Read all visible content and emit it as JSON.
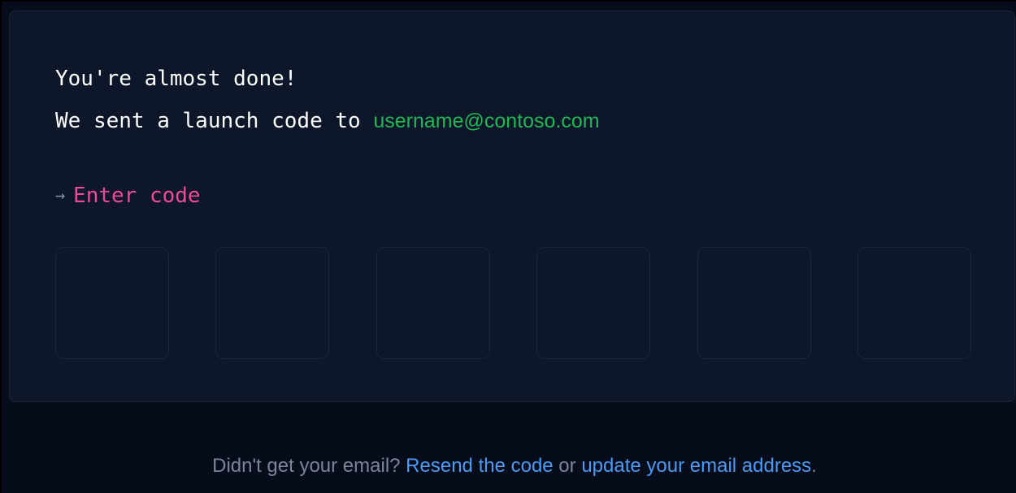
{
  "heading": {
    "line1": "You're almost done!",
    "line2_prefix": "We sent a launch code to ",
    "email": "username@contoso.com"
  },
  "prompt": {
    "arrow_icon": "→",
    "label": "Enter code"
  },
  "code_inputs": [
    {
      "value": ""
    },
    {
      "value": ""
    },
    {
      "value": ""
    },
    {
      "value": ""
    },
    {
      "value": ""
    },
    {
      "value": ""
    }
  ],
  "footer": {
    "question": "Didn't get your email? ",
    "resend_link": "Resend the code",
    "connector": " or ",
    "update_link": "update your email address",
    "end": "."
  },
  "colors": {
    "background": "#070c1a",
    "card": "#0e1629",
    "email": "#1fb954",
    "prompt": "#ec4a9a",
    "link": "#4b9af5",
    "muted": "#7c8597"
  }
}
